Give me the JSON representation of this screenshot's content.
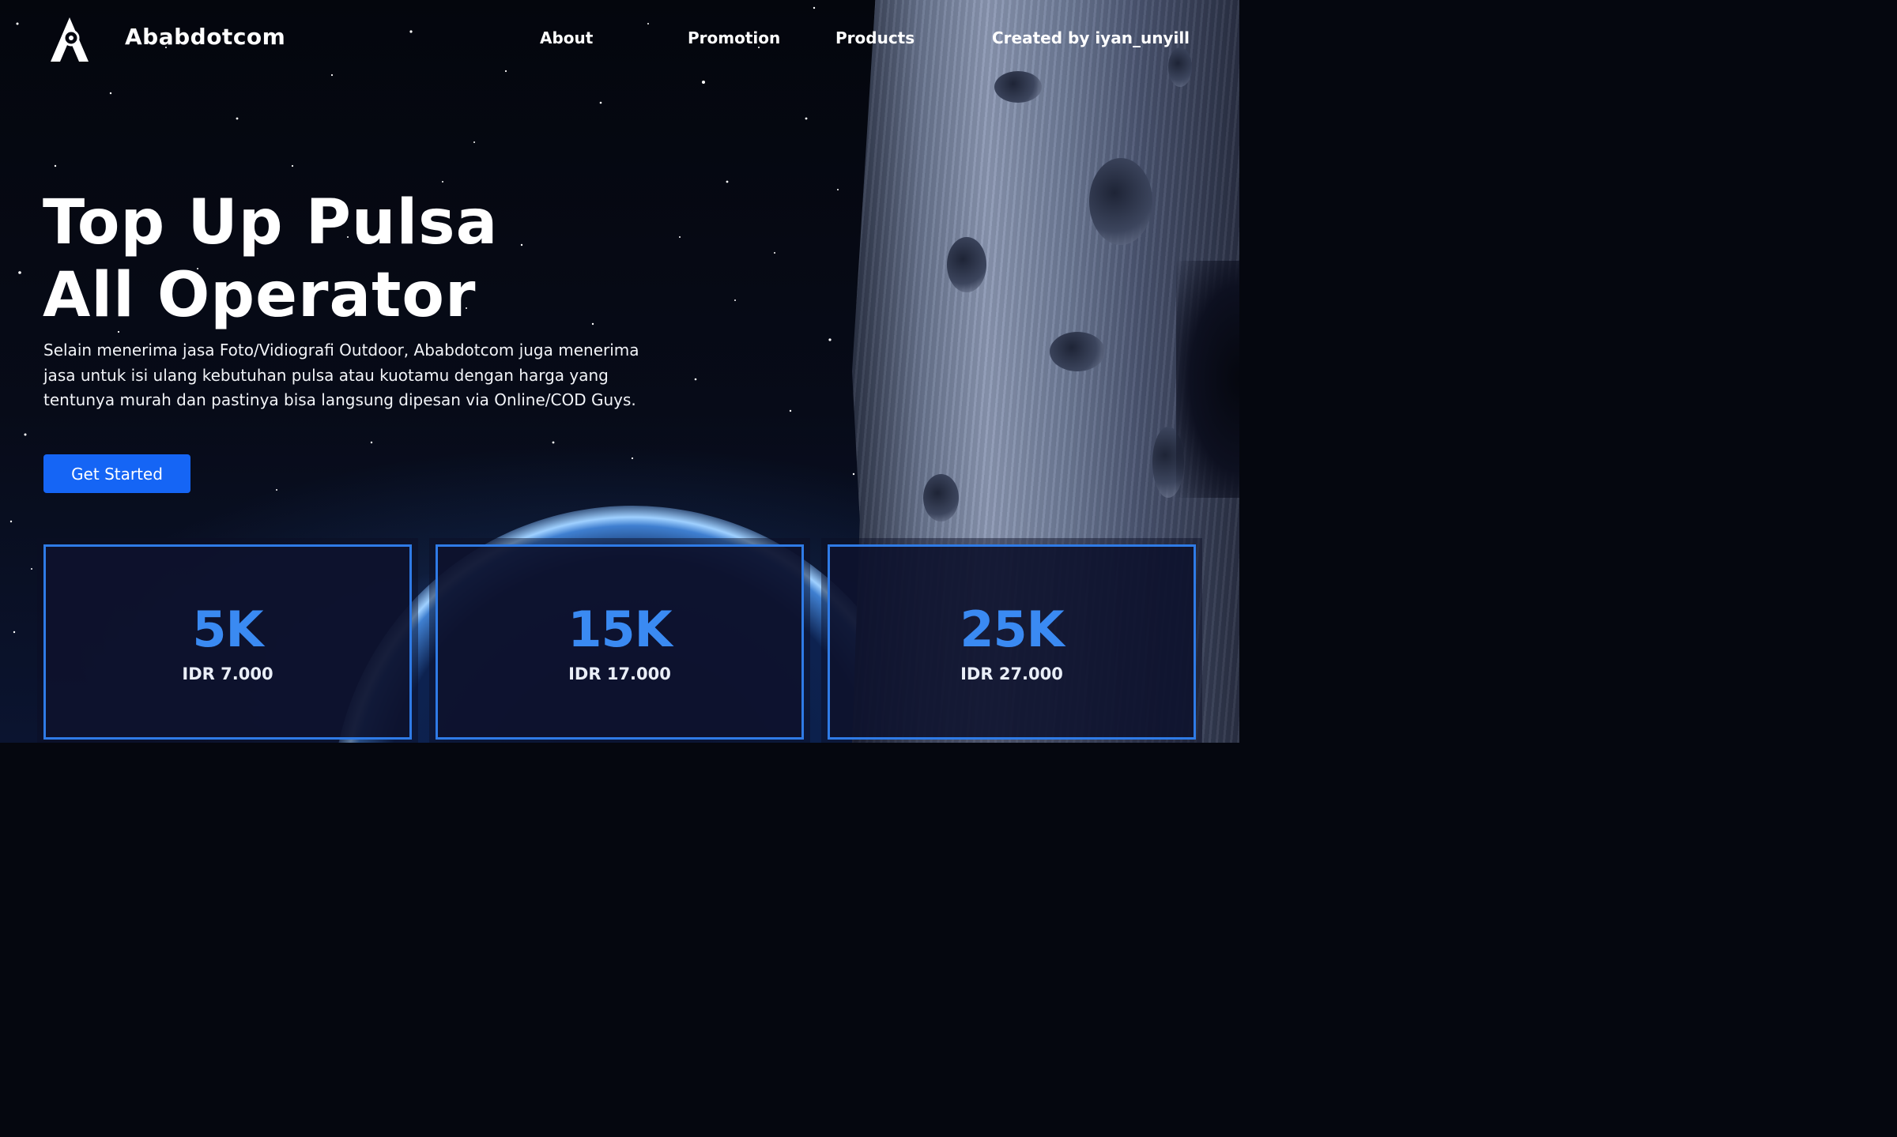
{
  "header": {
    "brand": "Ababdotcom",
    "logo_icon": "compass-logo-icon",
    "nav": [
      {
        "label": "About"
      },
      {
        "label": "Promotion"
      },
      {
        "label": "Products"
      },
      {
        "label": "Created by iyan_unyill"
      }
    ]
  },
  "hero": {
    "title_line1": "Top Up Pulsa",
    "title_line2": "All Operator",
    "description": "Selain menerima jasa Foto/Vidiografi Outdoor, Ababdotcom juga menerima jasa untuk isi ulang kebutuhan pulsa atau kuotamu dengan harga yang tentunya murah dan pastinya bisa langsung dipesan via Online/COD Guys.",
    "cta_label": "Get Started"
  },
  "cards": [
    {
      "amount": "5K",
      "price": "IDR 7.000"
    },
    {
      "amount": "15K",
      "price": "IDR 17.000"
    },
    {
      "amount": "25K",
      "price": "IDR 27.000"
    }
  ],
  "colors": {
    "accent": "#1565f5",
    "card_border": "#2f7be6",
    "card_amount": "#3a8af2"
  }
}
